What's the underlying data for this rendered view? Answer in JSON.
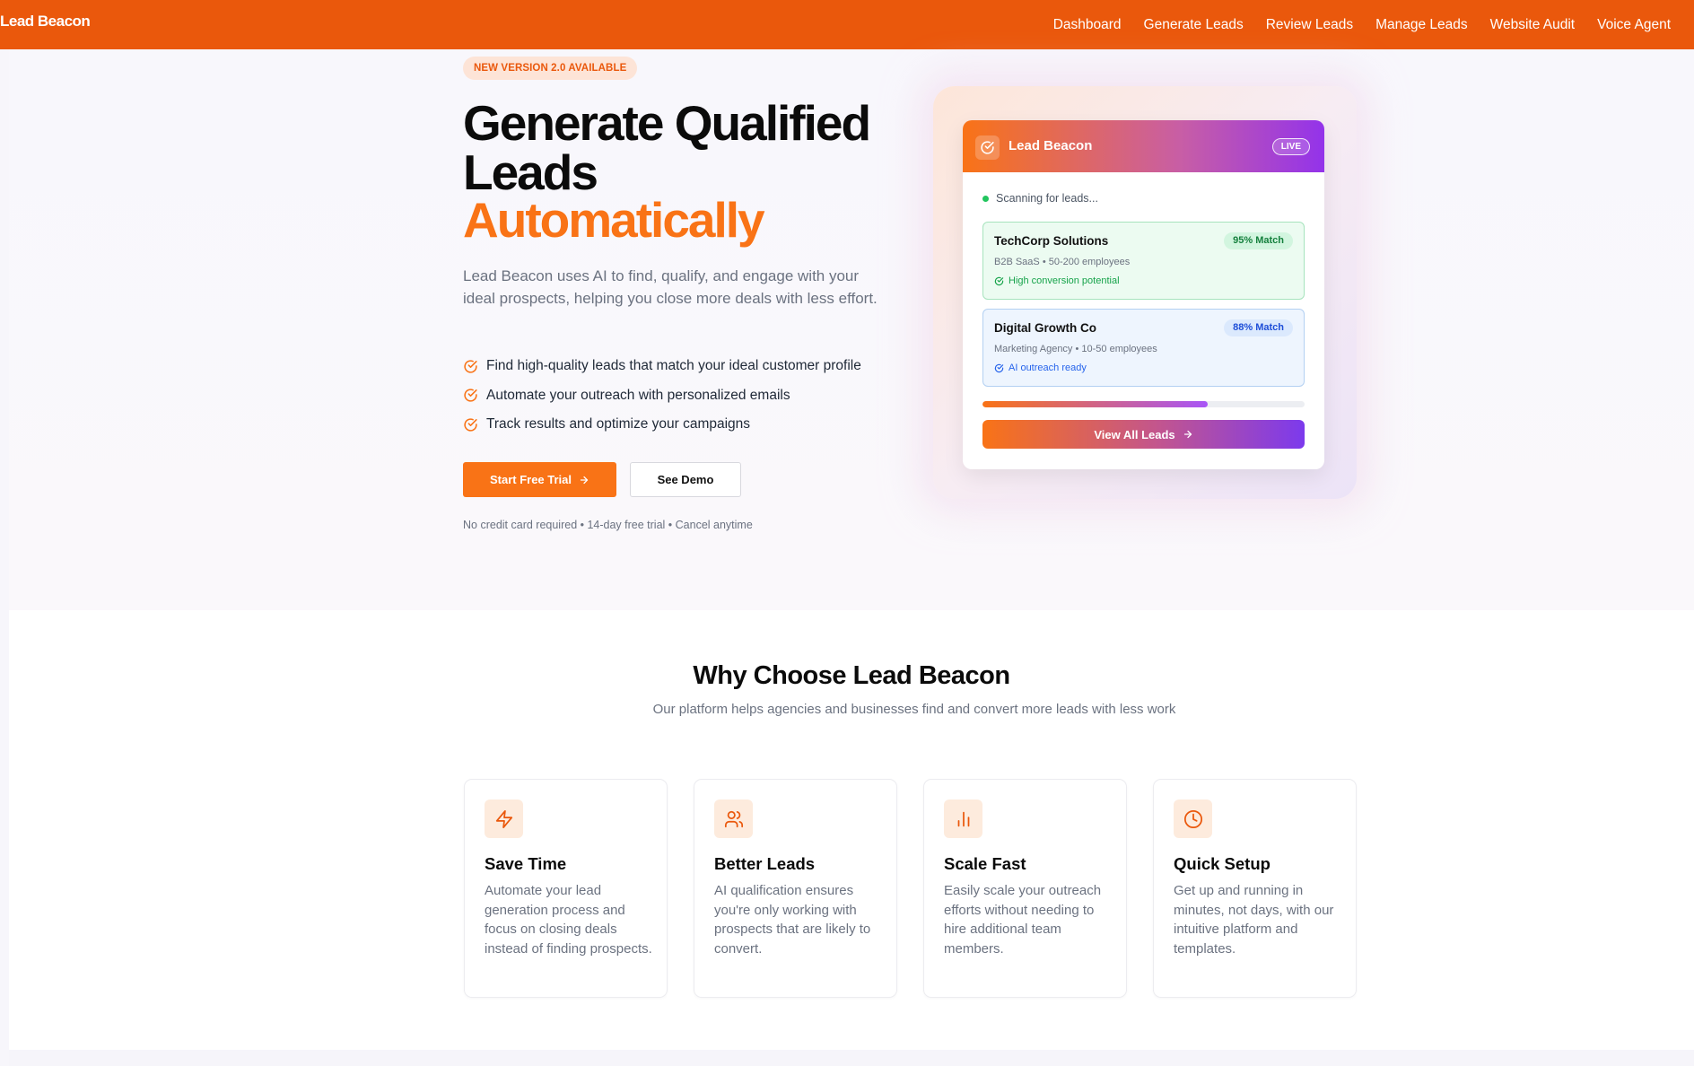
{
  "nav": {
    "brand": "Lead Beacon",
    "links": [
      "Dashboard",
      "Generate Leads",
      "Review Leads",
      "Manage Leads",
      "Website Audit",
      "Voice Agent"
    ]
  },
  "hero": {
    "badge": "NEW VERSION 2.0 AVAILABLE",
    "title_line1": "Generate Qualified",
    "title_line2": "Leads",
    "title_line3": "Automatically",
    "description": "Lead Beacon uses AI to find, qualify, and engage with your ideal prospects, helping you close more deals with less effort.",
    "features": [
      "Find high-quality leads that match your ideal customer profile",
      "Automate your outreach with personalized emails",
      "Track results and optimize your campaigns"
    ],
    "primary_button": "Start Free Trial",
    "secondary_button": "See Demo",
    "fineprint": "No credit card required • 14-day free trial • Cancel anytime"
  },
  "preview_card": {
    "title": "Lead Beacon",
    "live_label": "LIVE",
    "status": "Scanning for leads...",
    "leads": [
      {
        "name": "TechCorp Solutions",
        "meta": "B2B SaaS • 50-200 employees",
        "tag": "High conversion potential",
        "match": "95% Match"
      },
      {
        "name": "Digital Growth Co",
        "meta": "Marketing Agency • 10-50 employees",
        "tag": "AI outreach ready",
        "match": "88% Match"
      }
    ],
    "progress": 0.7,
    "view_all": "View All Leads"
  },
  "why": {
    "title": "Why Choose Lead Beacon",
    "subtitle": "Our platform helps agencies and businesses find and convert more leads with less work",
    "cards": [
      {
        "icon": "lightning-icon",
        "title": "Save Time",
        "desc": "Automate your lead generation process and focus on closing deals instead of finding prospects."
      },
      {
        "icon": "users-icon",
        "title": "Better Leads",
        "desc": "AI qualification ensures you're only working with prospects that are likely to convert."
      },
      {
        "icon": "bar-chart-icon",
        "title": "Scale Fast",
        "desc": "Easily scale your outreach efforts without needing to hire additional team members."
      },
      {
        "icon": "clock-icon",
        "title": "Quick Setup",
        "desc": "Get up and running in minutes, not days, with our intuitive platform and templates."
      }
    ]
  },
  "colors": {
    "brand": "#ea580c",
    "accent": "#f97316",
    "purple": "#9333ea",
    "success": "#16a34a",
    "info": "#2563eb"
  }
}
